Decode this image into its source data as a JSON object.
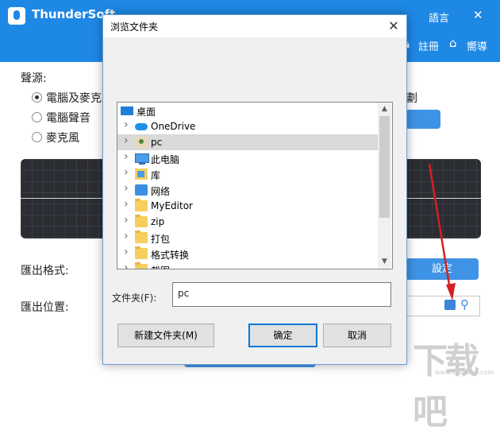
{
  "app": {
    "title": "ThunderSoft",
    "lang_label": "語言",
    "register_label": "註冊",
    "guide_label": "嚮導",
    "sound_source_label": "聲源:",
    "sources": [
      "電腦及麥克",
      "電腦聲音",
      "麥克風"
    ],
    "right_text": "劃",
    "export_format_label": "匯出格式:",
    "export_location_label": "匯出位置:",
    "settings_label": "設定"
  },
  "dialog": {
    "title": "浏览文件夹",
    "close_glyph": "✕",
    "tree": [
      {
        "label": "桌面",
        "icon": "desktop-icon",
        "expander": false
      },
      {
        "label": "OneDrive",
        "icon": "cloud-icon",
        "expander": true
      },
      {
        "label": "pc",
        "icon": "user-icon",
        "expander": true
      },
      {
        "label": "此电脑",
        "icon": "computer-icon",
        "expander": true
      },
      {
        "label": "库",
        "icon": "library-icon",
        "expander": true
      },
      {
        "label": "网络",
        "icon": "network-icon",
        "expander": true
      },
      {
        "label": "MyEditor",
        "icon": "folder-icon",
        "expander": true
      },
      {
        "label": "zip",
        "icon": "folder-icon",
        "expander": true
      },
      {
        "label": "打包",
        "icon": "folder-icon",
        "expander": true
      },
      {
        "label": "格式转换",
        "icon": "folder-icon",
        "expander": true
      },
      {
        "label": "截图",
        "icon": "folder-icon",
        "expander": true
      }
    ],
    "selected_index": 2,
    "folder_label": "文件夹(F):",
    "folder_value": "pc",
    "new_folder_label": "新建文件夹(M)",
    "ok_label": "确定",
    "cancel_label": "取消"
  },
  "watermark": {
    "text": "下载吧",
    "sub": "www.xiazaiba.com"
  },
  "colors": {
    "accent": "#1e88e5",
    "arrow": "#d42020"
  }
}
